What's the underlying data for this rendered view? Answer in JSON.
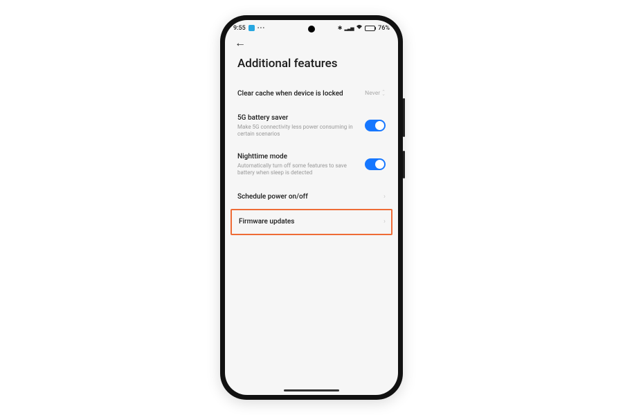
{
  "status": {
    "time": "9:55",
    "battery_pct": "76%",
    "bt_icon": "✱",
    "signal_icon": "▯ıl",
    "wifi_icon": "ᯤ"
  },
  "nav": {
    "back_glyph": "←"
  },
  "page": {
    "title": "Additional features"
  },
  "rows": {
    "cache": {
      "title": "Clear cache when device is locked",
      "value": "Never"
    },
    "fiveg": {
      "title": "5G battery saver",
      "sub": "Make 5G connectivity less power consuming in certain scenarios",
      "on": true
    },
    "night": {
      "title": "Nighttime mode",
      "sub": "Automatically turn off some features to save battery when sleep is detected",
      "on": true
    },
    "schedule": {
      "title": "Schedule power on/off"
    },
    "firmware": {
      "title": "Firmware updates"
    }
  }
}
